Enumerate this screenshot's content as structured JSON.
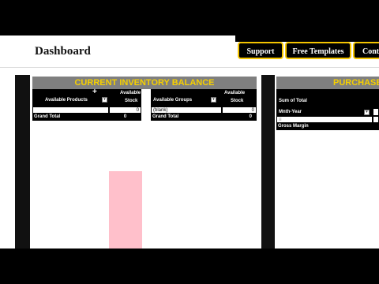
{
  "page": {
    "title": "Dashboard"
  },
  "nav": {
    "support": "Support",
    "templates": "Free Templates",
    "contact": "Conta"
  },
  "inventory": {
    "title": "CURRENT INVENTORY BALANCE",
    "products": {
      "col1_header": "Available Products",
      "col2_header_line1": "Available",
      "col2_header_line2": "Stock",
      "row_value": "0",
      "total_label": "Grand Total",
      "total_value": "0"
    },
    "groups": {
      "col1_header": "Available Groups",
      "col2_header_line1": "Available",
      "col2_header_line2": "Stock",
      "row_label": "(blank)",
      "row_value": "0",
      "total_label": "Grand Total",
      "total_value": "0"
    },
    "chart_data": {
      "type": "bar",
      "categories": [
        ""
      ],
      "values": [
        null
      ],
      "color": "#ffc0cb"
    }
  },
  "purchase": {
    "title": "PURCHASE",
    "sum_label": "Sum of Total",
    "filter_label": "Mnth-Year",
    "row_label": "Gross Margin"
  },
  "colors": {
    "accent": "#f6d000",
    "button_border": "#f4c400",
    "panel_header": "#7f7f7f"
  }
}
